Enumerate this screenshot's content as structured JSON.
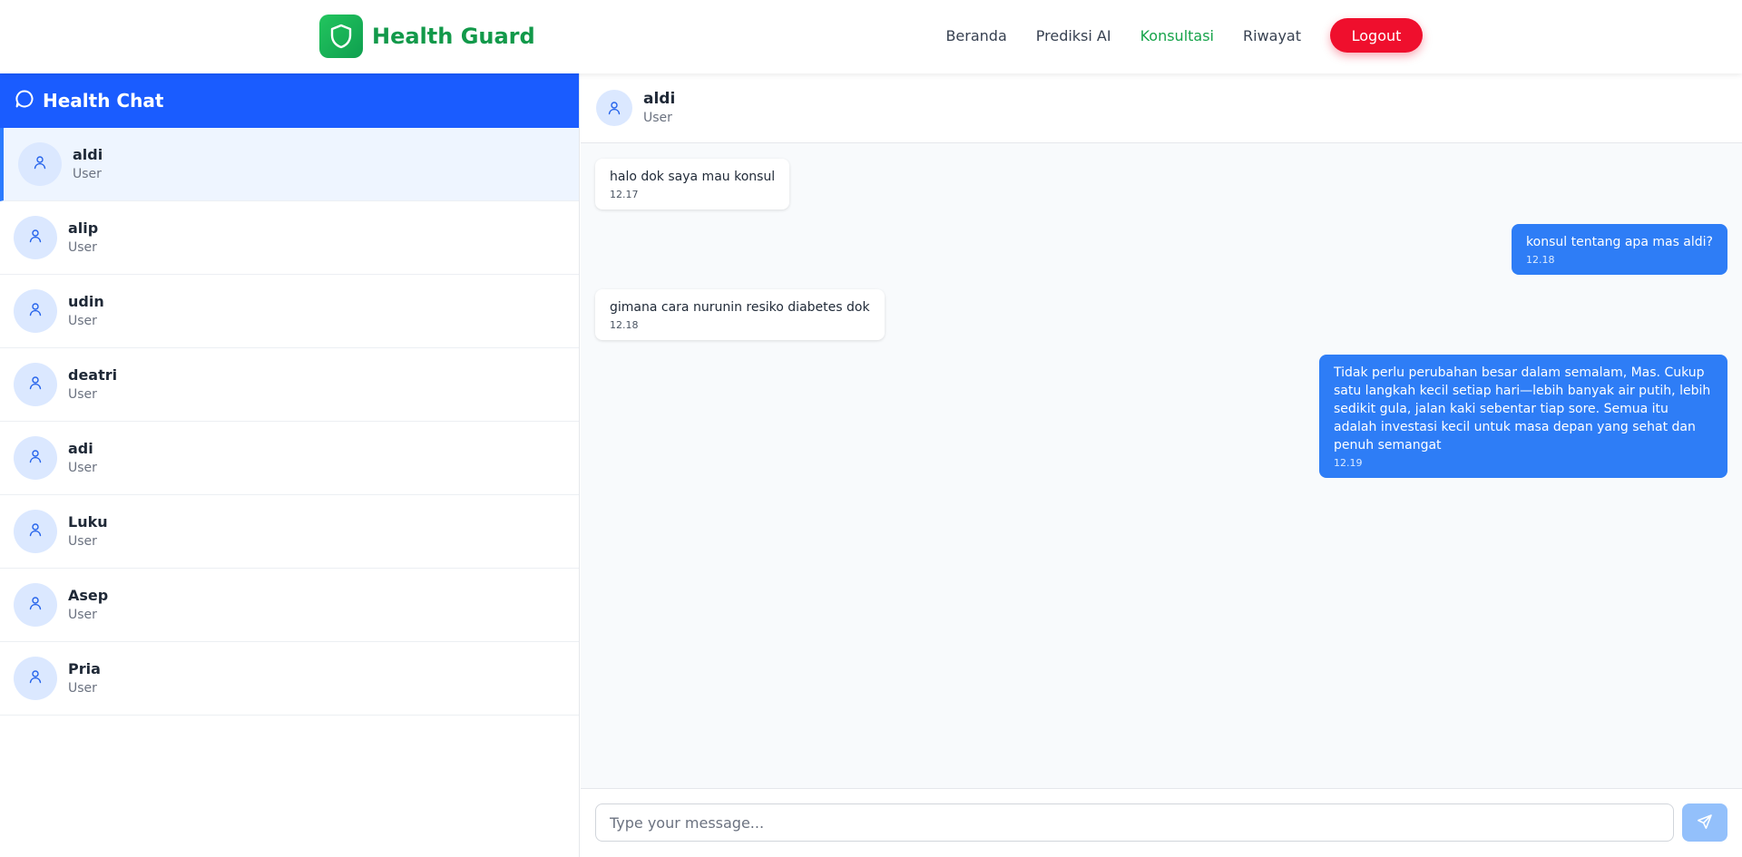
{
  "brand": {
    "name": "Health Guard",
    "icon": "shield-icon",
    "color": "#12994a"
  },
  "nav": {
    "links": [
      {
        "label": "Beranda",
        "active": false
      },
      {
        "label": "Prediksi AI",
        "active": false
      },
      {
        "label": "Konsultasi",
        "active": true
      },
      {
        "label": "Riwayat",
        "active": false
      }
    ],
    "logout_label": "Logout"
  },
  "sidebar": {
    "title": "Health Chat",
    "icon": "chat-bubble-icon",
    "contacts": [
      {
        "name": "aldi",
        "role": "User",
        "active": true
      },
      {
        "name": "alip",
        "role": "User",
        "active": false
      },
      {
        "name": "udin",
        "role": "User",
        "active": false
      },
      {
        "name": "deatri",
        "role": "User",
        "active": false
      },
      {
        "name": "adi",
        "role": "User",
        "active": false
      },
      {
        "name": "Luku",
        "role": "User",
        "active": false
      },
      {
        "name": "Asep",
        "role": "User",
        "active": false
      },
      {
        "name": "Pria",
        "role": "User",
        "active": false
      }
    ]
  },
  "chat": {
    "user_name": "aldi",
    "user_role": "User",
    "messages": [
      {
        "direction": "in",
        "text": "halo dok saya mau konsul",
        "time": "12.17"
      },
      {
        "direction": "out",
        "text": "konsul tentang apa mas aldi?",
        "time": "12.18"
      },
      {
        "direction": "in",
        "text": "gimana cara nurunin resiko diabetes dok",
        "time": "12.18"
      },
      {
        "direction": "out",
        "text": "Tidak perlu perubahan besar dalam semalam, Mas. Cukup satu langkah kecil setiap hari—lebih banyak air putih, lebih sedikit gula, jalan kaki sebentar tiap sore. Semua itu adalah investasi kecil untuk masa depan yang sehat dan penuh semangat",
        "time": "12.19"
      }
    ],
    "input": {
      "value": "",
      "placeholder": "Type your message..."
    },
    "send_icon": "send-icon"
  },
  "colors": {
    "accent_blue": "#1a5cff",
    "bubble_out": "#2e7df6",
    "logout_red": "#ef0f2d",
    "active_nav": "#16a34a"
  }
}
